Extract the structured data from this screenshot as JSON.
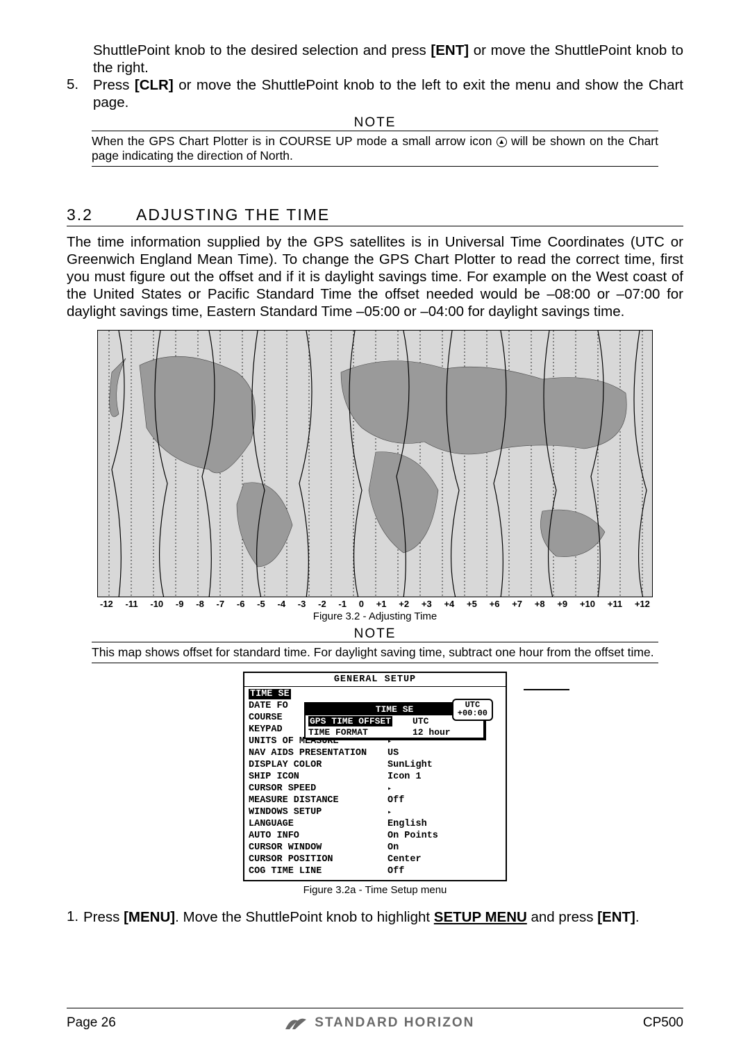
{
  "intro": {
    "cont": "ShuttlePoint knob to the desired selection and press [ENT] or move the ShuttlePoint knob to the right.",
    "key1": "[ENT]",
    "step5_num": "5.",
    "step5": "Press [CLR] or move the ShuttlePoint knob to the left to exit the menu and show the Chart page.",
    "key2": "[CLR]"
  },
  "note1": {
    "label": "NOTE",
    "text_a": "When the GPS Chart Plotter is in COURSE UP mode a small arrow  icon ",
    "text_b": " will be shown on the Chart page indicating the direction of North."
  },
  "section": {
    "num": "3.2",
    "title": "ADJUSTING THE TIME",
    "para": "The time information supplied by the GPS satellites is in Universal Time Coordinates (UTC or Greenwich England Mean Time). To change the GPS Chart Plotter to read the correct time, first you must figure out the offset and if it is daylight savings time. For example on the West coast of the United States or Pacific Standard Time the offset needed would be –08:00 or –07:00 for daylight savings time, Eastern Standard Time –05:00 or –04:00 for daylight savings time."
  },
  "fig1": {
    "caption": "Figure 3.2 - Adjusting Time",
    "axis": [
      "-12",
      "-11",
      "-10",
      "-9",
      "-8",
      "-7",
      "-6",
      "-5",
      "-4",
      "-3",
      "-2",
      "-1",
      "0",
      "+1",
      "+2",
      "+3",
      "+4",
      "+5",
      "+6",
      "+7",
      "+8",
      "+9",
      "+10",
      "+11",
      "+12"
    ]
  },
  "note2": {
    "label": "NOTE",
    "text": "This map shows offset for standard time. For daylight saving time, subtract one hour from the offset time."
  },
  "menu": {
    "title": "GENERAL SETUP",
    "rows": [
      {
        "l": "TIME SE",
        "v": "",
        "hl": true
      },
      {
        "l": "DATE FO",
        "v": ""
      },
      {
        "l": "COURSE",
        "v": ""
      },
      {
        "l": "KEYPAD",
        "v": ""
      },
      {
        "l": "UNITS OF MEASURE",
        "v": "▸"
      },
      {
        "l": "NAV AIDS PRESENTATION",
        "v": "US"
      },
      {
        "l": "DISPLAY COLOR",
        "v": "SunLight"
      },
      {
        "l": "SHIP ICON",
        "v": "Icon 1"
      },
      {
        "l": "CURSOR SPEED",
        "v": "▸"
      },
      {
        "l": "MEASURE DISTANCE",
        "v": "Off"
      },
      {
        "l": "WINDOWS SETUP",
        "v": "▸"
      },
      {
        "l": "LANGUAGE",
        "v": "English"
      },
      {
        "l": "AUTO INFO",
        "v": "On Points"
      },
      {
        "l": "CURSOR WINDOW",
        "v": "On"
      },
      {
        "l": "CURSOR POSITION",
        "v": "Center"
      },
      {
        "l": "COG TIME LINE",
        "v": "Off"
      }
    ],
    "popup": {
      "title": "TIME SE",
      "rows": [
        {
          "l": "GPS TIME OFFSET",
          "v": "UTC",
          "hl": true
        },
        {
          "l": "TIME FORMAT",
          "v": "12 hour"
        }
      ]
    },
    "utc": {
      "l": "UTC",
      "v": "+00:00"
    }
  },
  "fig2": {
    "caption": "Figure 3.2a - Time Setup menu"
  },
  "step1": {
    "num": "1.",
    "a": "Press ",
    "b": "[MENU]",
    "c": ". Move the ShuttlePoint knob to highlight ",
    "d": "SETUP MENU",
    "e": " and press ",
    "f": "[ENT]",
    "g": "."
  },
  "footer": {
    "page": "Page 26",
    "brand": "STANDARD HORIZON",
    "model": "CP500"
  }
}
